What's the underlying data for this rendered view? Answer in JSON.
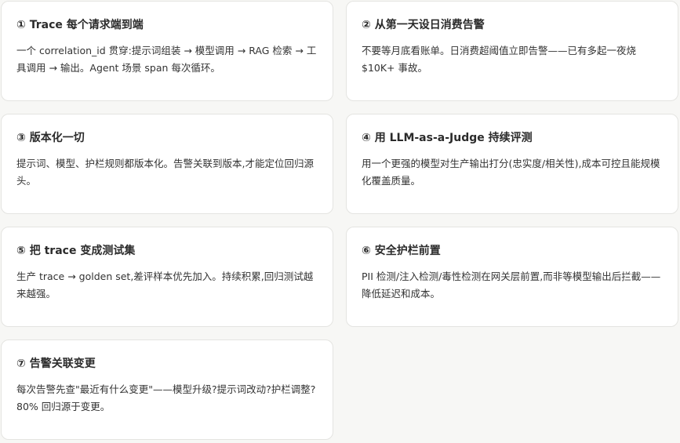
{
  "cards": [
    {
      "title": "① Trace 每个请求端到端",
      "body": "一个 correlation_id 贯穿:提示词组装 → 模型调用 → RAG 检索 → 工具调用 → 输出。Agent 场景 span 每次循环。"
    },
    {
      "title": "② 从第一天设日消费告警",
      "body": "不要等月底看账单。日消费超阈值立即告警——已有多起一夜烧 $10K+ 事故。"
    },
    {
      "title": "③ 版本化一切",
      "body": "提示词、模型、护栏规则都版本化。告警关联到版本,才能定位回归源头。"
    },
    {
      "title": "④ 用 LLM-as-a-Judge 持续评测",
      "body": "用一个更强的模型对生产输出打分(忠实度/相关性),成本可控且能规模化覆盖质量。"
    },
    {
      "title": "⑤ 把 trace 变成测试集",
      "body": "生产 trace → golden set,差评样本优先加入。持续积累,回归测试越来越强。"
    },
    {
      "title": "⑥ 安全护栏前置",
      "body": "PII 检测/注入检测/毒性检测在网关层前置,而非等模型输出后拦截——降低延迟和成本。"
    },
    {
      "title": "⑦ 告警关联变更",
      "body": "每次告警先查\"最近有什么变更\"——模型升级?提示词改动?护栏调整?80% 回归源于变更。"
    }
  ]
}
